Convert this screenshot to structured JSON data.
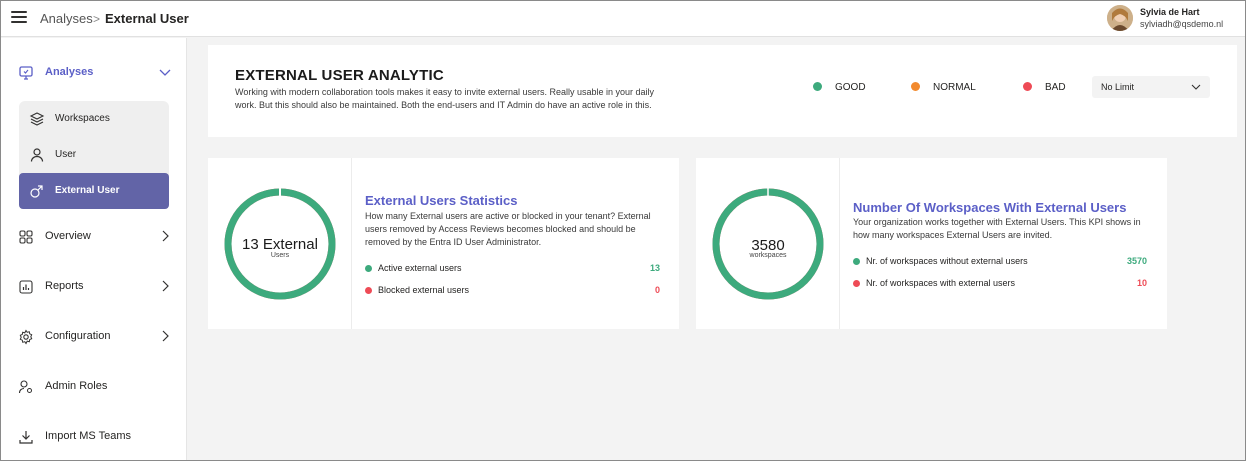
{
  "breadcrumb": {
    "parent": "Analyses",
    "separator": ">",
    "current": "External User"
  },
  "user": {
    "name": "Sylvia de Hart",
    "email": "sylviadh@qsdemo.nl"
  },
  "sidebar": {
    "analyses_label": "Analyses",
    "sub_items": [
      {
        "label": "Workspaces",
        "icon": "layers-icon"
      },
      {
        "label": "User",
        "icon": "person-icon"
      },
      {
        "label": "External User",
        "icon": "external-user-icon",
        "active": true
      }
    ],
    "items": [
      {
        "label": "Overview",
        "icon": "grid-icon"
      },
      {
        "label": "Reports",
        "icon": "report-icon"
      },
      {
        "label": "Configuration",
        "icon": "gear-icon"
      },
      {
        "label": "Admin Roles",
        "icon": "admin-roles-icon"
      },
      {
        "label": "Import MS Teams",
        "icon": "download-icon"
      }
    ]
  },
  "header": {
    "title": "EXTERNAL USER ANALYTIC",
    "description": "Working with modern collaboration tools makes it easy to invite external users. Really usable in your daily work. But this should also be maintained. Both the end-users and IT Admin do have an active role in this.",
    "legend": [
      {
        "label": "GOOD",
        "color": "#3daa7d"
      },
      {
        "label": "NORMAL",
        "color": "#f28a2e"
      },
      {
        "label": "BAD",
        "color": "#ee4b56"
      }
    ],
    "filter": {
      "selected": "No Limit"
    }
  },
  "kpis": {
    "external_users": {
      "donut_value": "13 External",
      "donut_caption": "Users",
      "title": "External Users Statistics",
      "description": "How many External users are active or blocked in your tenant? External users removed by Access Reviews becomes blocked and should be removed by the Entra ID User Administrator.",
      "rows": [
        {
          "label": "Active external users",
          "value": "13",
          "color": "#3daa7d"
        },
        {
          "label": "Blocked external users",
          "value": "0",
          "color": "#ee4b56"
        }
      ],
      "ring": {
        "good": 13,
        "bad": 0
      }
    },
    "workspaces": {
      "donut_value": "3580",
      "donut_caption": "workspaces",
      "title": "Number Of Workspaces With External Users",
      "description": "Your organization works together with External Users. This KPI shows in how many workspaces External Users are invited.",
      "rows": [
        {
          "label": "Nr. of workspaces without external users",
          "value": "3570",
          "color": "#3daa7d"
        },
        {
          "label": "Nr. of workspaces with external users",
          "value": "10",
          "color": "#ee4b56"
        }
      ],
      "ring": {
        "good": 3570,
        "bad": 10
      }
    }
  },
  "colors": {
    "accent": "#5b5fc7",
    "active_nav": "#6264a7",
    "good": "#3daa7d",
    "bad": "#ee4b56"
  }
}
